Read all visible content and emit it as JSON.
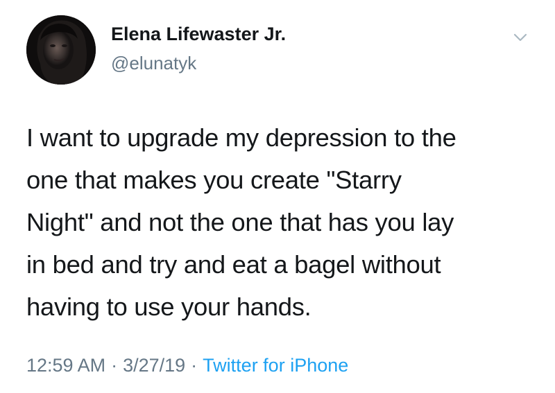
{
  "user": {
    "display_name": "Elena Lifewaster Jr.",
    "handle": "@elunatyk"
  },
  "tweet": {
    "lines": [
      "I want to upgrade my depression to the",
      "one that makes you create \"Starry",
      "Night\" and not the one that has you lay",
      "in bed and try and eat a bagel without",
      "having to use your hands."
    ]
  },
  "meta": {
    "time": "12:59 AM",
    "separator": "·",
    "date": "3/27/19",
    "source": "Twitter for iPhone"
  },
  "icons": {
    "menu": "chevron-down-icon",
    "avatar": "avatar"
  },
  "colors": {
    "text": "#14171a",
    "secondary": "#657786",
    "link": "#1da1f2"
  }
}
